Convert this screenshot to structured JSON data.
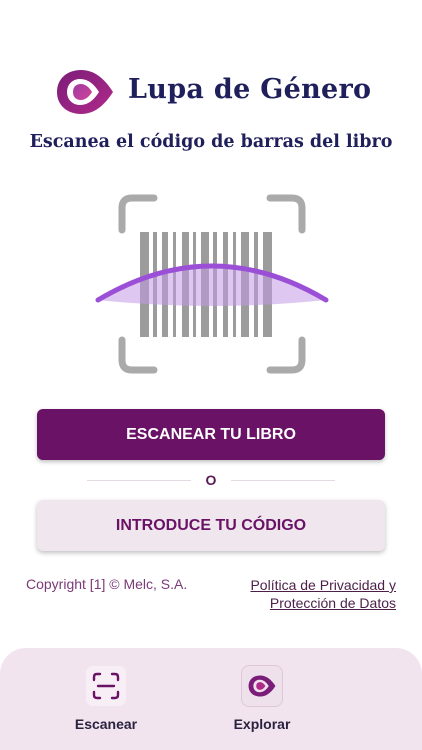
{
  "app": {
    "title": "Lupa de Género",
    "subtitle": "Escanea el código de barras del libro"
  },
  "actions": {
    "scan_button": "ESCANEAR TU LIBRO",
    "divider_text": "O",
    "code_button": "INTRODUCE TU CÓDIGO"
  },
  "footer": {
    "copyright": "Copyright [1] © Melc, S.A.",
    "policy_line1": "Política de Privacidad y",
    "policy_line2": "Protección de Datos"
  },
  "tabbar": {
    "tabs": [
      {
        "label": "Escanear",
        "icon": "scan-icon"
      },
      {
        "label": "Explorar",
        "icon": "eye-drop-icon"
      }
    ]
  },
  "colors": {
    "brand_purple": "#6a1266",
    "title_navy": "#1f1f5c",
    "scan_arc": "#9b4fd6",
    "tabbar_bg": "#f1e4ee"
  }
}
